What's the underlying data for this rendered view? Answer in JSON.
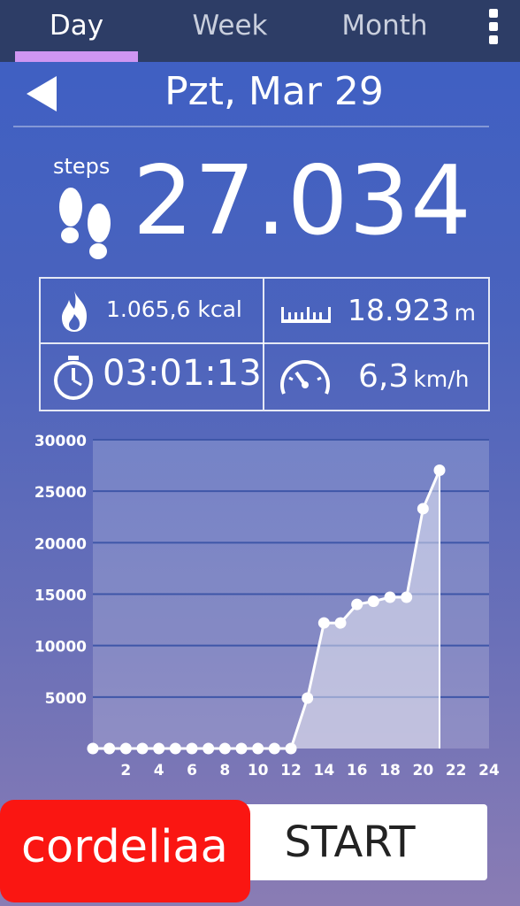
{
  "tabs": [
    {
      "label": "Day",
      "active": true
    },
    {
      "label": "Week"
    },
    {
      "label": "Month"
    }
  ],
  "header": {
    "date": "Pzt, Mar 29"
  },
  "steps": {
    "label": "steps",
    "value": "27.034"
  },
  "stats": {
    "calories": {
      "value": "1.065,6",
      "unit": "kcal",
      "icon": "flame-icon"
    },
    "distance": {
      "value": "18.923",
      "unit": "m",
      "icon": "ruler-icon"
    },
    "duration": {
      "value": "03:01:13",
      "icon": "stopwatch-icon"
    },
    "speed": {
      "value": "6,3",
      "unit": "km/h",
      "icon": "speedometer-icon"
    }
  },
  "chart_data": {
    "type": "area",
    "x": [
      0,
      1,
      2,
      3,
      4,
      5,
      6,
      7,
      8,
      9,
      10,
      11,
      12,
      13,
      14,
      15,
      16,
      17,
      18,
      19,
      20,
      21
    ],
    "values": [
      0,
      0,
      0,
      0,
      0,
      0,
      0,
      0,
      0,
      0,
      0,
      0,
      0,
      4900,
      12200,
      12200,
      14000,
      14300,
      14700,
      14700,
      23300,
      27034
    ],
    "x_ticks": [
      "2",
      "4",
      "6",
      "8",
      "10",
      "12",
      "14",
      "16",
      "18",
      "20",
      "22",
      "24"
    ],
    "y_ticks": [
      "5000",
      "10000",
      "15000",
      "20000",
      "25000",
      "30000"
    ],
    "xlim": [
      0,
      24
    ],
    "ylim": [
      0,
      30000
    ],
    "grid": true
  },
  "start_button": {
    "label": "START"
  },
  "watermark": {
    "text": "cordeliaa"
  }
}
